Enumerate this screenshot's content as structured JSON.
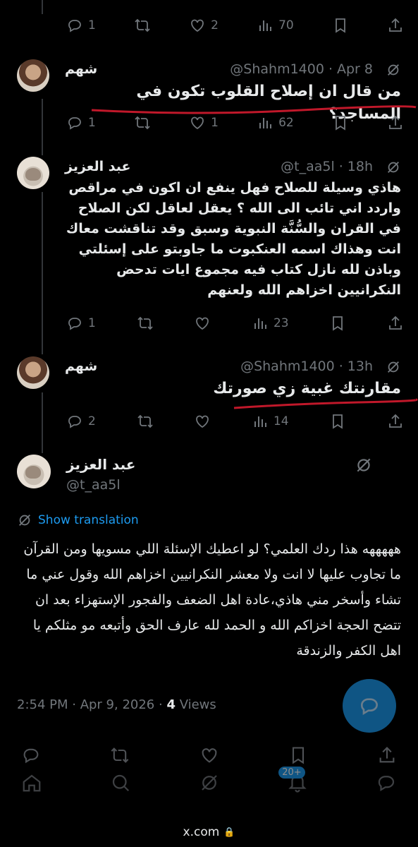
{
  "tweets": [
    {
      "name": "شهم",
      "handle": "@Shahm1400",
      "sep": "·",
      "time": "Apr 8",
      "text": "من قال ان إصلاح القلوب تكون في المساجد؟",
      "replies": "1",
      "retweets": "",
      "likes": "1",
      "views": "62"
    },
    {
      "name": "عبد العزيز",
      "handle": "@t_aa5l",
      "sep": "·",
      "time": "18h",
      "text": "هاذي وسيلة للصلاح فهل ينفع ان اكون في مراقص واردد اني تائب الى الله ؟ يعقل لعاقل لكن الصلاح في القران والسُّنَّة النبوية وسبق وقد تناقشت معاك انت وهذاك اسمه العنكبوت ما جاوبتو على إسئلتي وباذن لله نازل كتاب فيه مجموع ايات تدحض النكرانيين اخزاهم الله ولعنهم",
      "replies": "1",
      "retweets": "",
      "likes": "",
      "views": "23"
    },
    {
      "name": "شهم",
      "handle": "@Shahm1400",
      "sep": "·",
      "time": "13h",
      "text": "مقارنتك غبية زي صورتك",
      "replies": "2",
      "retweets": "",
      "likes": "",
      "views": "14"
    }
  ],
  "top_actions": {
    "replies": "1",
    "likes": "2",
    "views": "70"
  },
  "main": {
    "name": "عبد العزيز",
    "handle": "@t_aa5l",
    "show_translation": "Show translation",
    "text": "هههههه هذا ردك العلمي؟ لو اعطيك الإسئلة اللي مسويها ومن القرآن ما تجاوب عليها لا انت ولا معشر النكرانيين اخزاهم الله وقول عني ما تشاء وأسخر مني هاذي،عادة اهل الضعف والفجور الإستهزاء بعد ان تتضح الحجة اخزاكم الله و الحمد لله عارف الحق وأتبعه مو مثلكم يا اهل الكفر والزندقة",
    "timestamp": "2:54 PM · Apr 9, 2026 · ",
    "views_count": "4",
    "views_label": " Views"
  },
  "nav": {
    "badge": "20+"
  },
  "browser": {
    "url": "x.com"
  },
  "colors": {
    "accent": "#1d9bf0",
    "muted": "#71767b",
    "underline": "#c0182a",
    "bg": "#000000"
  }
}
